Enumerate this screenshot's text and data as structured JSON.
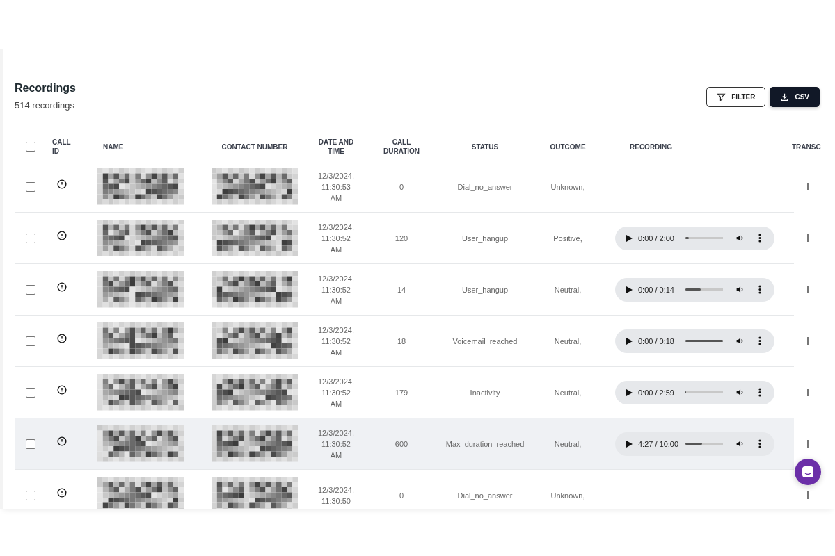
{
  "header": {
    "title": "Recordings",
    "count": "514 recordings"
  },
  "buttons": [
    {
      "kind": "filter",
      "label": "FILTER"
    },
    {
      "kind": "download",
      "label": "CSV"
    }
  ],
  "table": {
    "columns": [
      {
        "kind": "check",
        "checked": false
      },
      {
        "kind": "callid",
        "label": "CALL ID"
      },
      {
        "kind": "name",
        "label": "NAME"
      },
      {
        "kind": "contact",
        "label": "CONTACT NUMBER"
      },
      {
        "kind": "date",
        "label": "DATE AND TIME"
      },
      {
        "kind": "duration",
        "label": "CALL DURATION"
      },
      {
        "kind": "status",
        "label": "STATUS"
      },
      {
        "kind": "outcome",
        "label": "OUTCOME"
      },
      {
        "kind": "recording",
        "label": "RECORDING"
      },
      {
        "kind": "transcript",
        "label": "TRANSC"
      }
    ],
    "rows": [
      {
        "checked": false,
        "highlighted": false,
        "date": "12/3/2024, 11:30:53 AM",
        "duration": "0",
        "status": "Dial_no_answer",
        "outcome": "Unknown,"
      },
      {
        "checked": false,
        "highlighted": false,
        "date": "12/3/2024, 11:30:52 AM",
        "duration": "120",
        "status": "User_hangup",
        "outcome": "Positive,",
        "player": {
          "time": "0:00 / 2:00",
          "level": 0.1
        }
      },
      {
        "checked": false,
        "highlighted": false,
        "date": "12/3/2024, 11:30:52 AM",
        "duration": "14",
        "status": "User_hangup",
        "outcome": "Neutral,",
        "player": {
          "time": "0:00 / 0:14",
          "level": 0.4
        }
      },
      {
        "checked": false,
        "highlighted": false,
        "date": "12/3/2024, 11:30:52 AM",
        "duration": "18",
        "status": "Voicemail_reached",
        "outcome": "Neutral,",
        "player": {
          "time": "0:00 / 0:18",
          "level": 1
        }
      },
      {
        "checked": false,
        "highlighted": false,
        "date": "12/3/2024, 11:30:52 AM",
        "duration": "179",
        "status": "Inactivity",
        "outcome": "Neutral,",
        "player": {
          "time": "0:00 / 2:59",
          "level": 0.02
        }
      },
      {
        "checked": false,
        "highlighted": true,
        "date": "12/3/2024, 11:30:52 AM",
        "duration": "600",
        "status": "Max_duration_reached",
        "outcome": "Neutral,",
        "player": {
          "time": "4:27 / 10:00",
          "level": 0.45
        }
      },
      {
        "checked": false,
        "highlighted": false,
        "date": "12/3/2024, 11:30:50",
        "duration": "0",
        "status": "Dial_no_answer",
        "outcome": "Unknown,"
      }
    ]
  }
}
